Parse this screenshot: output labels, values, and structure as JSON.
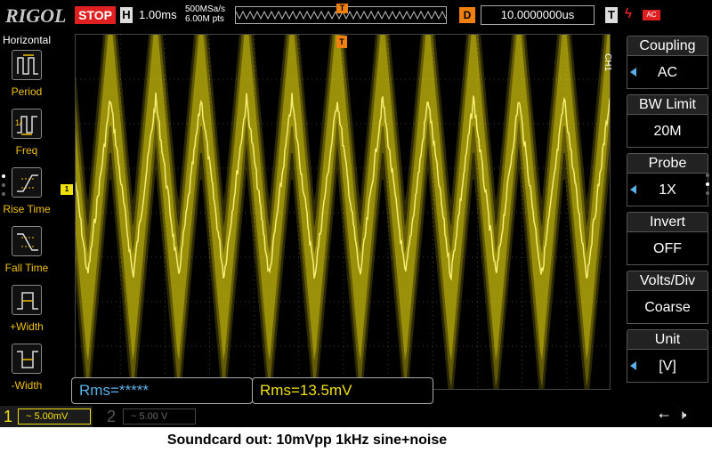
{
  "topbar": {
    "logo": "RIGOL",
    "run_state": "STOP",
    "horizontal_badge": "H",
    "timebase": "1.00ms",
    "sample_rate": "500MSa/s",
    "memory_depth": "6.00M pts",
    "trigger_marker": "T",
    "delay_badge": "D",
    "delay_value": "10.0000000us",
    "trigger_badge": "T",
    "trigger_coupling": "AC"
  },
  "left_panel": {
    "title": "Horizontal",
    "items": [
      {
        "label": "Period",
        "icon": "period-icon"
      },
      {
        "label": "Freq",
        "icon": "frequency-icon"
      },
      {
        "label": "Rise Time",
        "icon": "rise-time-icon"
      },
      {
        "label": "Fall Time",
        "icon": "fall-time-icon"
      },
      {
        "label": "+Width",
        "icon": "positive-width-icon"
      },
      {
        "label": "-Width",
        "icon": "negative-width-icon"
      }
    ]
  },
  "screen": {
    "trigger_position_marker": "T",
    "ch1_ground_marker": "1",
    "trace_color": "#f0e010"
  },
  "measurements": {
    "left": "Rms=*****",
    "right": "Rms=13.5mV"
  },
  "right_panel": {
    "channel_tag": "CH1",
    "groups": [
      {
        "head": "Coupling",
        "value": "AC"
      },
      {
        "head": "BW Limit",
        "value": "20M"
      },
      {
        "head": "Probe",
        "value": "1X"
      },
      {
        "head": "Invert",
        "value": "OFF"
      },
      {
        "head": "Volts/Div",
        "value": "Coarse"
      },
      {
        "head": "Unit",
        "value": "[V]"
      }
    ]
  },
  "bottombar": {
    "ch1_number": "1",
    "ch1_scale": "~ 5.00mV",
    "ch2_number": "2",
    "ch2_scale": "~ 5.00 V"
  },
  "caption": "Soundcard out: 10mVpp 1kHz sine+noise"
}
